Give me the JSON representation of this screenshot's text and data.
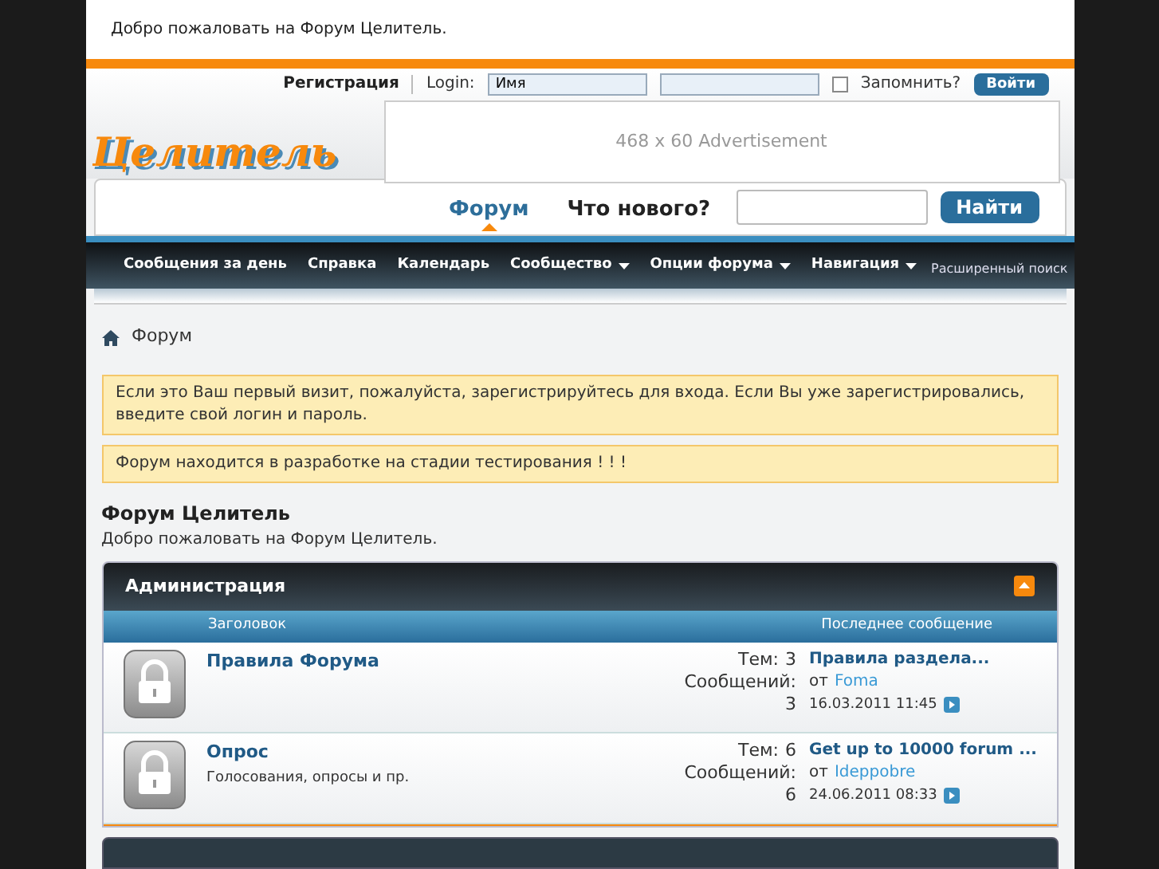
{
  "welcome": "Добро пожаловать на Форум Целитель.",
  "login": {
    "register": "Регистрация",
    "label": "Login:",
    "username": "Имя",
    "remember": "Запомнить?",
    "remember_checked": false,
    "button": "Войти"
  },
  "logo": "Целитель",
  "ad": "468 x 60 Advertisement",
  "tabs": [
    {
      "label": "Форум",
      "selected": true
    },
    {
      "label": "Что нового?",
      "selected": false
    }
  ],
  "search_button": "Найти",
  "navbar": [
    {
      "label": "Сообщения за день",
      "dropdown": false
    },
    {
      "label": "Справка",
      "dropdown": false
    },
    {
      "label": "Календарь",
      "dropdown": false
    },
    {
      "label": "Сообщество",
      "dropdown": true
    },
    {
      "label": "Опции форума",
      "dropdown": true
    },
    {
      "label": "Навигация",
      "dropdown": true
    }
  ],
  "advanced_search": "Расширенный поиск",
  "breadcrumb": "Форум",
  "notices": [
    "Если это Ваш первый визит, пожалуйста, зарегистрируйтесь для входа. Если Вы уже зарегистрировались, введите свой логин и пароль.",
    "Форум находится в разработке на стадии тестирования ! ! !"
  ],
  "forum_title": "Форум Целитель",
  "forum_subtitle": "Добро пожаловать на Форум Целитель.",
  "category": {
    "title": "Администрация",
    "columns": [
      "Заголовок",
      "Последнее сообщение"
    ],
    "rows": [
      {
        "title": "Правила Форума",
        "description": null,
        "threads_label": "Тем:",
        "threads": "3",
        "posts_label": "Сообщений:",
        "posts": "3",
        "last_title": "Правила раздела...",
        "by": "от",
        "user": "Foma",
        "date": "16.03.2011 11:45"
      },
      {
        "title": "Опрос",
        "description": "Голосования, опросы и пр.",
        "threads_label": "Тем:",
        "threads": "6",
        "posts_label": "Сообщений:",
        "posts": "6",
        "last_title": "Get up to 10000 forum ...",
        "by": "от",
        "user": "Ideppobre",
        "date": "24.06.2011 08:33"
      }
    ]
  }
}
